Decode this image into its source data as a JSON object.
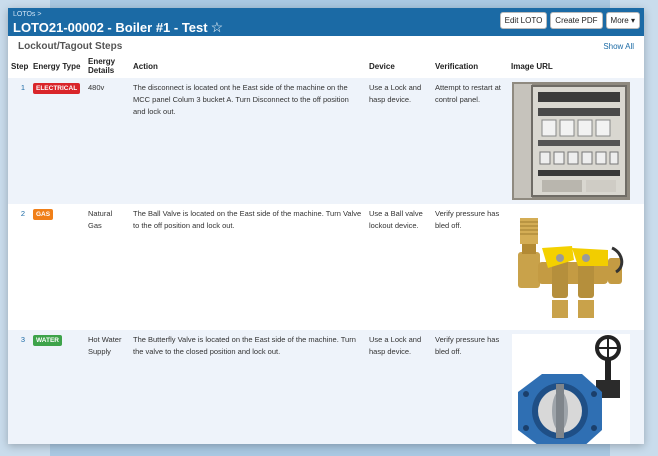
{
  "breadcrumb": "LOTOs >",
  "title": "LOTO21-00002 - Boiler #1 - Test",
  "buttons": {
    "edit": "Edit LOTO",
    "pdf": "Create PDF",
    "more": "More ▾"
  },
  "section": {
    "title": "Lockout/Tagout Steps",
    "show_all": "Show All"
  },
  "columns": {
    "step": "Step",
    "energy_type": "Energy Type",
    "energy_details": "Energy Details",
    "action": "Action",
    "device": "Device",
    "verification": "Verification",
    "image_url": "Image URL"
  },
  "steps": [
    {
      "number": "1",
      "energy_type": "ELECTRICAL",
      "badge_color": "#d9252a",
      "details": "480v",
      "action": "The disconnect is located ont he East side of the machine on the MCC panel Colum 3 bucket A. Turn Disconnect to the off position and lock out.",
      "device": "Use a Lock and hasp device.",
      "verification": "Attempt to restart at control panel.",
      "image": "electrical-panel-image"
    },
    {
      "number": "2",
      "energy_type": "GAS",
      "badge_color": "#f07f18",
      "details": "Natural Gas",
      "action": "The Ball Valve is located on the East side of the machine. Turn Valve to the off position and lock out.",
      "device": "Use a Ball valve lockout device.",
      "verification": "Verify pressure has bled off.",
      "image": "ball-valve-image"
    },
    {
      "number": "3",
      "energy_type": "WATER",
      "badge_color": "#3ea34a",
      "details": "Hot Water Supply",
      "action": "The Butterfly Valve is located on the East side of the machine. Turn the valve to the closed position and lock out.",
      "device": "Use a Lock and hasp device.",
      "verification": "Verify pressure has bled off.",
      "image": "butterfly-valve-image"
    }
  ]
}
